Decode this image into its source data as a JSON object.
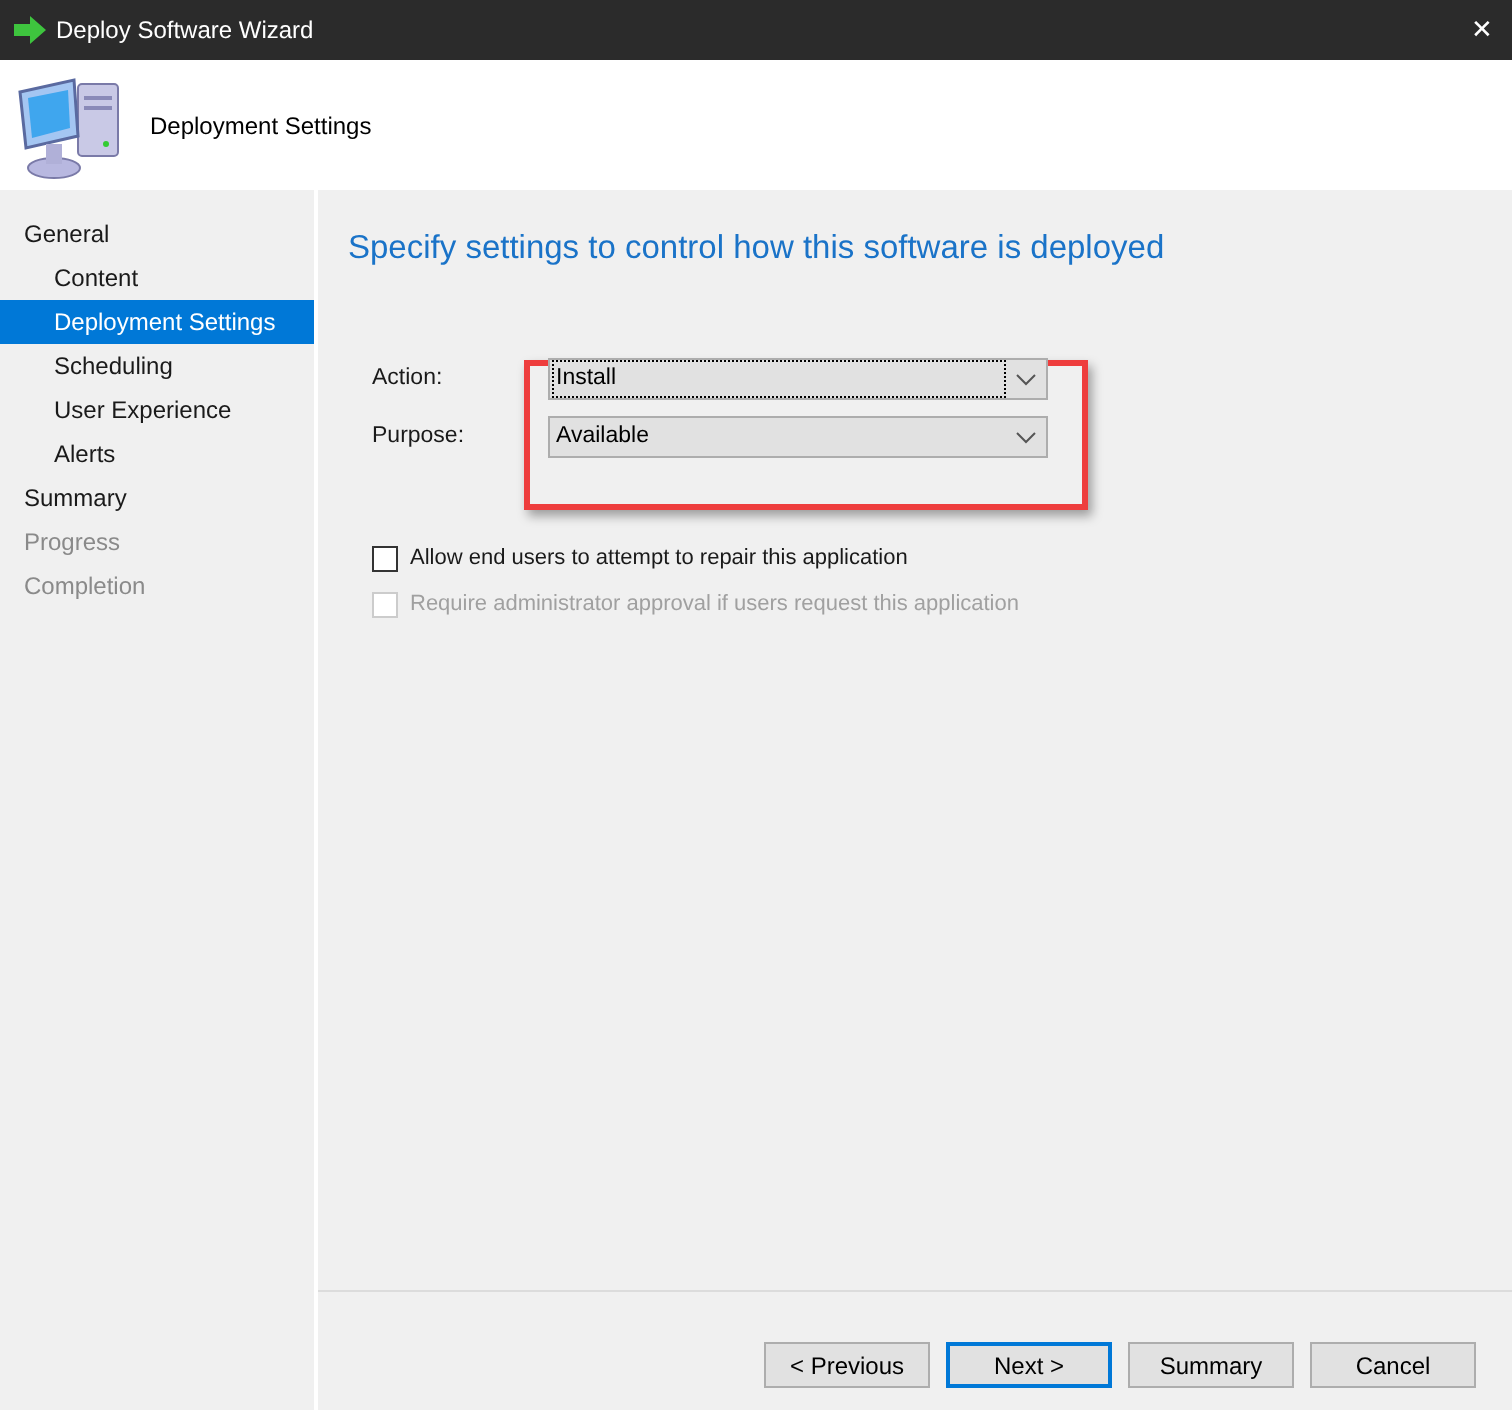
{
  "window": {
    "title": "Deploy Software Wizard",
    "close": "✕"
  },
  "header": {
    "title": "Deployment Settings"
  },
  "sidebar": {
    "items": [
      {
        "label": "General",
        "selected": false,
        "disabled": false,
        "children": [
          {
            "label": "Content",
            "selected": false,
            "disabled": false
          },
          {
            "label": "Deployment Settings",
            "selected": true,
            "disabled": false
          },
          {
            "label": "Scheduling",
            "selected": false,
            "disabled": false
          },
          {
            "label": "User Experience",
            "selected": false,
            "disabled": false
          },
          {
            "label": "Alerts",
            "selected": false,
            "disabled": false
          }
        ]
      },
      {
        "label": "Summary",
        "selected": false,
        "disabled": false
      },
      {
        "label": "Progress",
        "selected": false,
        "disabled": true
      },
      {
        "label": "Completion",
        "selected": false,
        "disabled": true
      }
    ]
  },
  "main": {
    "heading": "Specify settings to control how this software is deployed",
    "fields": [
      {
        "label": "Action:",
        "value": "Install",
        "focused": true
      },
      {
        "label": "Purpose:",
        "value": "Available",
        "focused": false
      }
    ],
    "highlighted": true,
    "checkboxes": [
      {
        "label": "Allow end users to attempt to repair this application",
        "checked": false,
        "disabled": false
      },
      {
        "label": "Require administrator approval if users request this application",
        "checked": false,
        "disabled": true
      }
    ]
  },
  "buttons": [
    {
      "label": "< Previous",
      "default": false
    },
    {
      "label": "Next >",
      "default": true
    },
    {
      "label": "Summary",
      "default": false
    },
    {
      "label": "Cancel",
      "default": false
    }
  ]
}
